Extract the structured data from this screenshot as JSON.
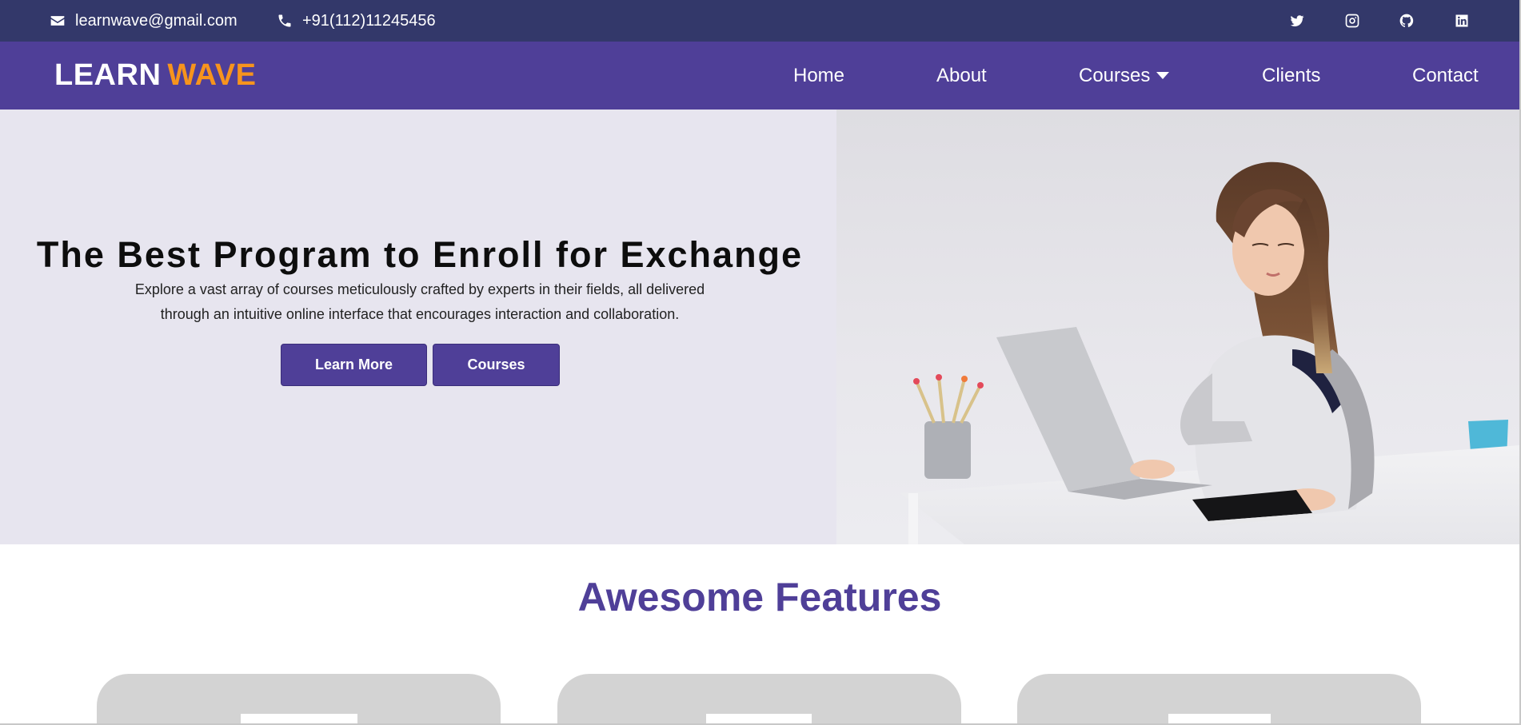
{
  "topbar": {
    "email": "learnwave@gmail.com",
    "phone": "+91(112)11245456",
    "social": [
      "twitter-icon",
      "instagram-icon",
      "github-icon",
      "linkedin-icon"
    ]
  },
  "nav": {
    "logo_part1": "LEARN",
    "logo_part2": "WAVE",
    "links": {
      "home": "Home",
      "about": "About",
      "courses": "Courses",
      "clients": "Clients",
      "contact": "Contact"
    }
  },
  "hero": {
    "title": "The Best Program to Enroll for Exchange",
    "subtitle_line1": "Explore a vast array of courses meticulously crafted by experts in their fields, all delivered",
    "subtitle_line2": "through an intuitive online interface that encourages interaction and collaboration.",
    "learn_more_label": "Learn More",
    "courses_label": "Courses"
  },
  "features": {
    "title": "Awesome Features"
  },
  "colors": {
    "topbar_bg": "#33386a",
    "nav_bg": "#4f3f98",
    "accent": "#f7941d",
    "hero_bg": "#e7e5ef",
    "card_bg": "#d3d3d3"
  }
}
